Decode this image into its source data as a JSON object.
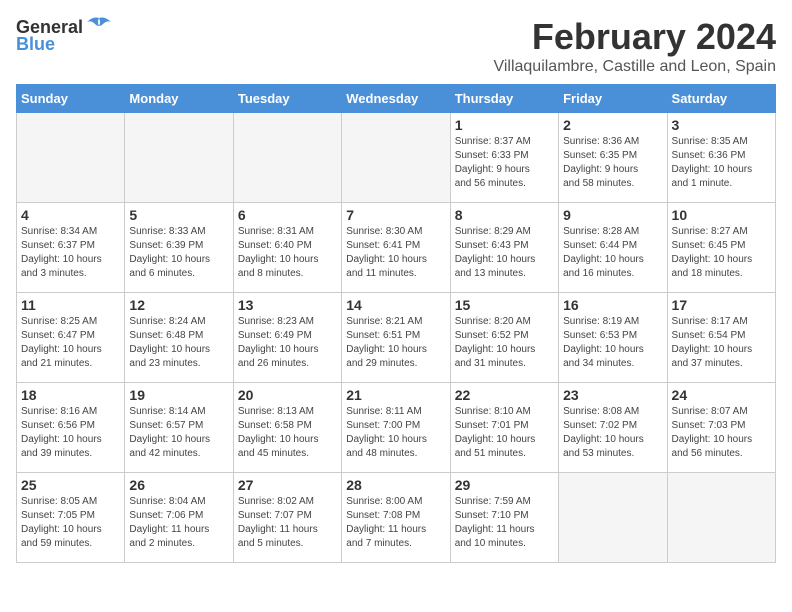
{
  "logo": {
    "general": "General",
    "blue": "Blue"
  },
  "header": {
    "title": "February 2024",
    "subtitle": "Villaquilambre, Castille and Leon, Spain"
  },
  "days_of_week": [
    "Sunday",
    "Monday",
    "Tuesday",
    "Wednesday",
    "Thursday",
    "Friday",
    "Saturday"
  ],
  "weeks": [
    [
      {
        "day": "",
        "info": "",
        "empty": true
      },
      {
        "day": "",
        "info": "",
        "empty": true
      },
      {
        "day": "",
        "info": "",
        "empty": true
      },
      {
        "day": "",
        "info": "",
        "empty": true
      },
      {
        "day": "1",
        "info": "Sunrise: 8:37 AM\nSunset: 6:33 PM\nDaylight: 9 hours\nand 56 minutes."
      },
      {
        "day": "2",
        "info": "Sunrise: 8:36 AM\nSunset: 6:35 PM\nDaylight: 9 hours\nand 58 minutes."
      },
      {
        "day": "3",
        "info": "Sunrise: 8:35 AM\nSunset: 6:36 PM\nDaylight: 10 hours\nand 1 minute."
      }
    ],
    [
      {
        "day": "4",
        "info": "Sunrise: 8:34 AM\nSunset: 6:37 PM\nDaylight: 10 hours\nand 3 minutes."
      },
      {
        "day": "5",
        "info": "Sunrise: 8:33 AM\nSunset: 6:39 PM\nDaylight: 10 hours\nand 6 minutes."
      },
      {
        "day": "6",
        "info": "Sunrise: 8:31 AM\nSunset: 6:40 PM\nDaylight: 10 hours\nand 8 minutes."
      },
      {
        "day": "7",
        "info": "Sunrise: 8:30 AM\nSunset: 6:41 PM\nDaylight: 10 hours\nand 11 minutes."
      },
      {
        "day": "8",
        "info": "Sunrise: 8:29 AM\nSunset: 6:43 PM\nDaylight: 10 hours\nand 13 minutes."
      },
      {
        "day": "9",
        "info": "Sunrise: 8:28 AM\nSunset: 6:44 PM\nDaylight: 10 hours\nand 16 minutes."
      },
      {
        "day": "10",
        "info": "Sunrise: 8:27 AM\nSunset: 6:45 PM\nDaylight: 10 hours\nand 18 minutes."
      }
    ],
    [
      {
        "day": "11",
        "info": "Sunrise: 8:25 AM\nSunset: 6:47 PM\nDaylight: 10 hours\nand 21 minutes."
      },
      {
        "day": "12",
        "info": "Sunrise: 8:24 AM\nSunset: 6:48 PM\nDaylight: 10 hours\nand 23 minutes."
      },
      {
        "day": "13",
        "info": "Sunrise: 8:23 AM\nSunset: 6:49 PM\nDaylight: 10 hours\nand 26 minutes."
      },
      {
        "day": "14",
        "info": "Sunrise: 8:21 AM\nSunset: 6:51 PM\nDaylight: 10 hours\nand 29 minutes."
      },
      {
        "day": "15",
        "info": "Sunrise: 8:20 AM\nSunset: 6:52 PM\nDaylight: 10 hours\nand 31 minutes."
      },
      {
        "day": "16",
        "info": "Sunrise: 8:19 AM\nSunset: 6:53 PM\nDaylight: 10 hours\nand 34 minutes."
      },
      {
        "day": "17",
        "info": "Sunrise: 8:17 AM\nSunset: 6:54 PM\nDaylight: 10 hours\nand 37 minutes."
      }
    ],
    [
      {
        "day": "18",
        "info": "Sunrise: 8:16 AM\nSunset: 6:56 PM\nDaylight: 10 hours\nand 39 minutes."
      },
      {
        "day": "19",
        "info": "Sunrise: 8:14 AM\nSunset: 6:57 PM\nDaylight: 10 hours\nand 42 minutes."
      },
      {
        "day": "20",
        "info": "Sunrise: 8:13 AM\nSunset: 6:58 PM\nDaylight: 10 hours\nand 45 minutes."
      },
      {
        "day": "21",
        "info": "Sunrise: 8:11 AM\nSunset: 7:00 PM\nDaylight: 10 hours\nand 48 minutes."
      },
      {
        "day": "22",
        "info": "Sunrise: 8:10 AM\nSunset: 7:01 PM\nDaylight: 10 hours\nand 51 minutes."
      },
      {
        "day": "23",
        "info": "Sunrise: 8:08 AM\nSunset: 7:02 PM\nDaylight: 10 hours\nand 53 minutes."
      },
      {
        "day": "24",
        "info": "Sunrise: 8:07 AM\nSunset: 7:03 PM\nDaylight: 10 hours\nand 56 minutes."
      }
    ],
    [
      {
        "day": "25",
        "info": "Sunrise: 8:05 AM\nSunset: 7:05 PM\nDaylight: 10 hours\nand 59 minutes."
      },
      {
        "day": "26",
        "info": "Sunrise: 8:04 AM\nSunset: 7:06 PM\nDaylight: 11 hours\nand 2 minutes."
      },
      {
        "day": "27",
        "info": "Sunrise: 8:02 AM\nSunset: 7:07 PM\nDaylight: 11 hours\nand 5 minutes."
      },
      {
        "day": "28",
        "info": "Sunrise: 8:00 AM\nSunset: 7:08 PM\nDaylight: 11 hours\nand 7 minutes."
      },
      {
        "day": "29",
        "info": "Sunrise: 7:59 AM\nSunset: 7:10 PM\nDaylight: 11 hours\nand 10 minutes."
      },
      {
        "day": "",
        "info": "",
        "empty": true
      },
      {
        "day": "",
        "info": "",
        "empty": true
      }
    ]
  ]
}
